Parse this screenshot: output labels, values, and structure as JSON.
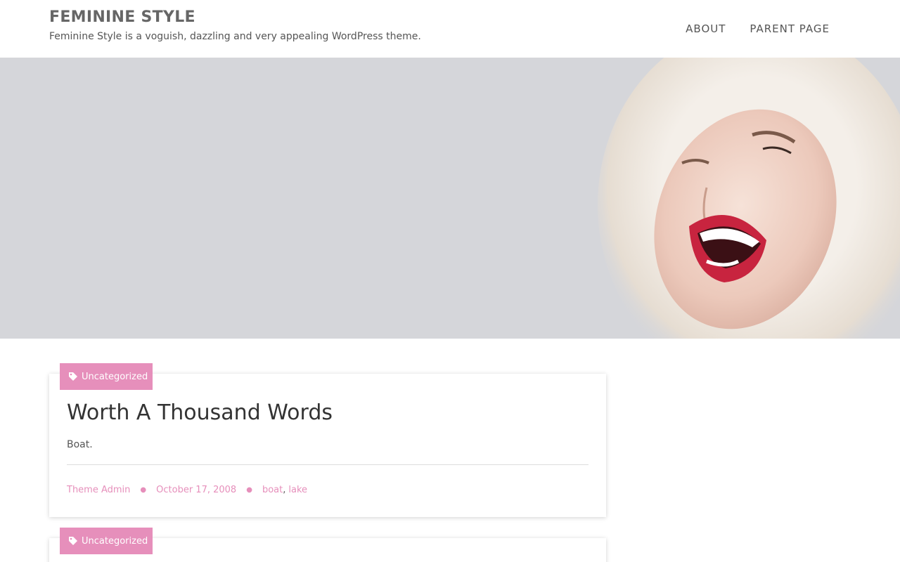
{
  "header": {
    "site_title": "FEMININE STYLE",
    "site_description": "Feminine Style is a voguish, dazzling and very appealing WordPress theme.",
    "nav": [
      "ABOUT",
      "PARENT PAGE"
    ]
  },
  "hero": {
    "image": "woman-in-fur-hood-laughing"
  },
  "posts": [
    {
      "category": "Uncategorized",
      "title": "Worth A Thousand Words",
      "excerpt": "Boat.",
      "author": "Theme Admin",
      "date": "October 17, 2008",
      "tags": [
        "boat",
        "lake"
      ]
    },
    {
      "category": "Uncategorized"
    }
  ],
  "colors": {
    "accent": "#e68fbb",
    "hero_bg": "#d5d6da"
  }
}
